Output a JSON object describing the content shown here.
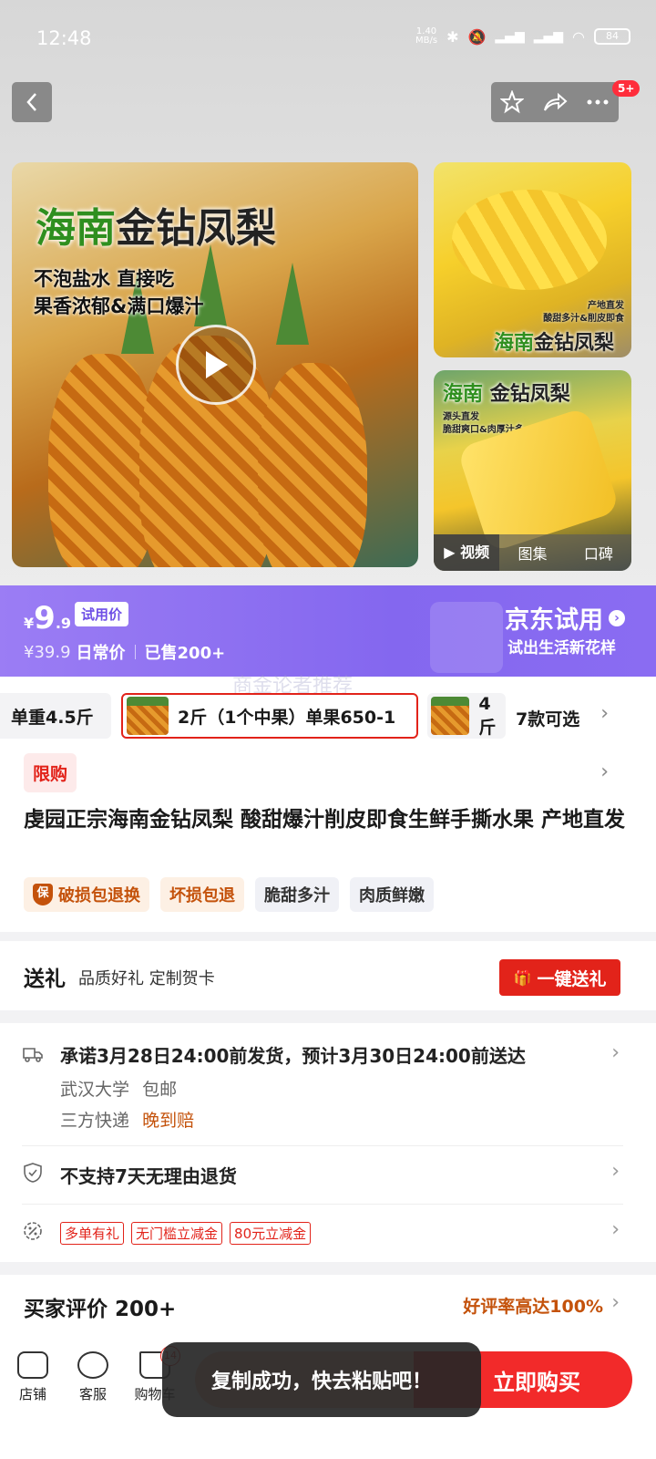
{
  "status_bar": {
    "time": "12:48",
    "speed": "1.40\nMB/s",
    "battery": "84"
  },
  "header": {
    "more_badge": "5+"
  },
  "gallery": {
    "main_title_green": "海南",
    "main_title_dark": "金钻凤梨",
    "main_sub1": "不泡盐水 直接吃",
    "main_sub2": "果香浓郁&满口爆汁",
    "side1_small1": "产地直发",
    "side1_small2": "酸甜多汁&削皮即食",
    "side1_green": "海南",
    "side1_dark": "金钻凤梨",
    "side2_green": "海南",
    "side2_dark": "金钻凤梨",
    "side2_small1": "源头直发",
    "side2_small2": "脆甜爽口&肉厚汁多",
    "tabs": [
      "▶ 视频",
      "图集",
      "口碑"
    ]
  },
  "price": {
    "yen": "¥",
    "integer": "9",
    "decimal": ".9",
    "trial_tag": "试用价",
    "original": "¥39.9",
    "original_label": "日常价",
    "sold": "已售200+",
    "jd_trial": "京东试用",
    "jd_slogan": "试出生活新花样"
  },
  "watermark": "商金论者推荐",
  "variants": {
    "left_partial": "单重4.5斤",
    "selected": "2斤（1个中果）单果650-1",
    "right_partial": "4斤",
    "more": "7款可选"
  },
  "product": {
    "limit_tag": "限购",
    "title": "虔园正宗海南金钻凤梨  酸甜爆汁削皮即食生鲜手撕水果 产地直发",
    "feature_tags": [
      "破损包退换",
      "坏损包退",
      "脆甜多汁",
      "肉质鲜嫩"
    ],
    "shield_glyph": "保"
  },
  "gift": {
    "title": "送礼",
    "subtitle": "品质好礼 定制贺卡",
    "button": "一键送礼"
  },
  "delivery": {
    "promise": "承诺3月28日24:00前发货，预计3月30日24:00前送达",
    "location": "武汉大学",
    "shipping_fee": "包邮",
    "courier": "三方快递",
    "late_comp": "晚到赔",
    "return_policy": "不支持7天无理由退货",
    "promo_tags": [
      "多单有礼",
      "无门槛立减金",
      "80元立减金"
    ]
  },
  "reviews": {
    "title": "买家评价 200+",
    "rate": "好评率高达100%"
  },
  "bottom_nav": {
    "store": "店铺",
    "service": "客服",
    "cart": "购物车",
    "cart_count": "14",
    "buy_now": "立即购买"
  },
  "toast": "复制成功，快去粘贴吧！"
}
